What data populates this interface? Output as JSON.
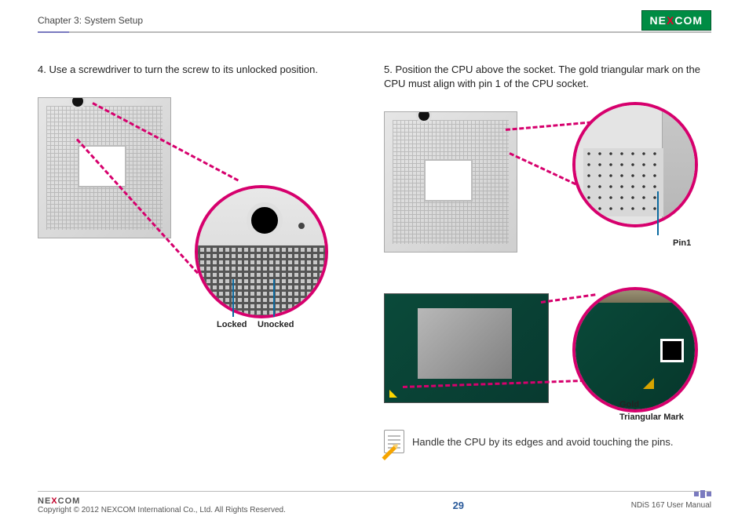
{
  "header": {
    "chapter": "Chapter 3: System Setup",
    "logo_prefix": "NE",
    "logo_x": "X",
    "logo_suffix": "COM"
  },
  "left": {
    "step": "4.  Use a screwdriver to turn the screw to its unlocked position.",
    "labels": {
      "locked": "Locked",
      "unlocked": "Unocked"
    }
  },
  "right": {
    "step": "5.  Position the CPU above the socket. The gold triangular mark on the CPU must align with pin 1 of the CPU socket.",
    "labels": {
      "pin1": "Pin1",
      "gold1": "Gold",
      "gold2": "Triangular Mark"
    },
    "note": "Handle the CPU by its edges and avoid touching the pins."
  },
  "footer": {
    "logo_prefix": "NE",
    "logo_x": "X",
    "logo_suffix": "COM",
    "copyright": "Copyright © 2012 NEXCOM International Co., Ltd. All Rights Reserved.",
    "page": "29",
    "manual": "NDiS 167 User Manual"
  }
}
